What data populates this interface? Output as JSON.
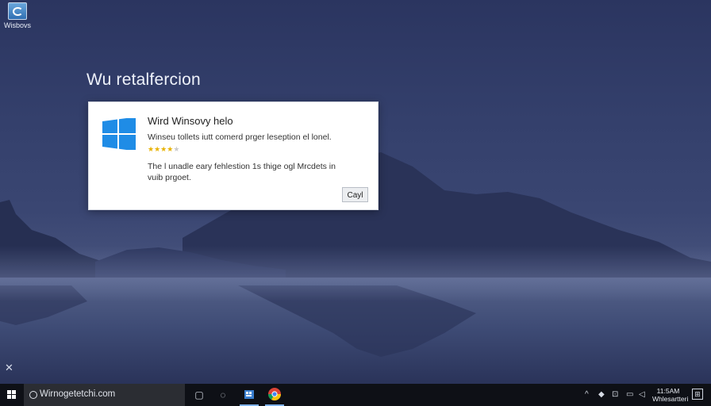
{
  "desktop": {
    "icon_label": "Wisbovs",
    "title": "Wu retalfercion"
  },
  "dialog": {
    "heading": "Wird Winsovy helo",
    "line1": "Winseu tollets iutt comerd prger leseption el lonel.",
    "rating": 4,
    "rating_max": 5,
    "body": "The l unadle eary fehlestion 1s thige ogl Mrcdets in vuib prgoet.",
    "button_label": "Cayl"
  },
  "taskbar": {
    "search_text": "Wirnogetetchi.com",
    "clock_line1": "11:5AM",
    "clock_line2": "Whlesartteri",
    "colors": {
      "background": "#0e1016",
      "search_bg": "#2b2d33",
      "accent": "#7fb2ea"
    }
  },
  "icons": {
    "desktop": "windows-setting-icon",
    "start": "windows-start-icon",
    "search": "search-icon",
    "task_view": "task-view-icon",
    "edge": "edge-icon",
    "store": "store-icon",
    "chrome": "chrome-icon",
    "close": "close-icon"
  }
}
